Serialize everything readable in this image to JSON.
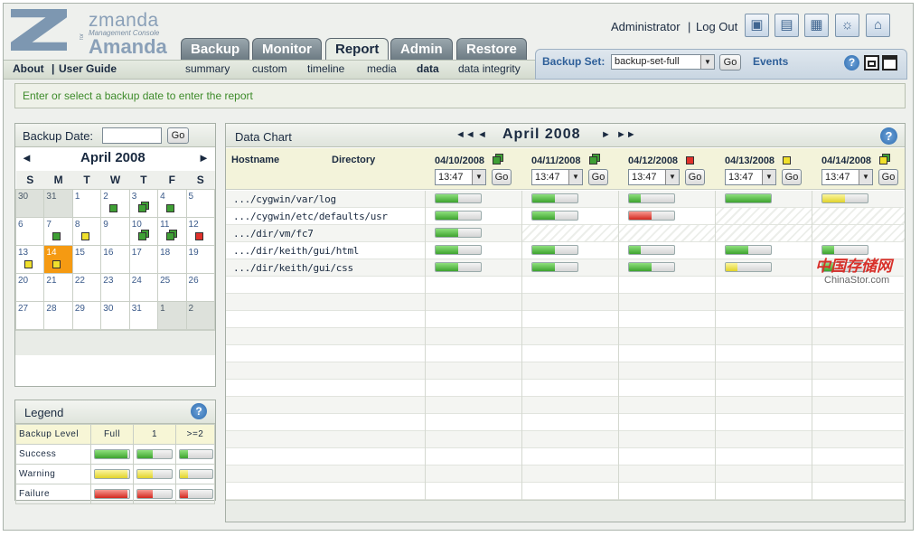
{
  "logo": {
    "brand": "zmanda",
    "tagline": "Management Console",
    "for": "for",
    "product": "Amanda"
  },
  "tabs": [
    {
      "label": "Backup"
    },
    {
      "label": "Monitor"
    },
    {
      "label": "Report",
      "active": true
    },
    {
      "label": "Admin"
    },
    {
      "label": "Restore"
    }
  ],
  "left_links": {
    "about": "About",
    "sep": "|",
    "guide": "User Guide"
  },
  "subtabs": [
    "summary",
    "custom",
    "timeline",
    "media",
    "data",
    "data integrity"
  ],
  "user": {
    "name": "Administrator",
    "sep": "|",
    "logout": "Log Out"
  },
  "top_icons": [
    "cart-icon",
    "book-icon",
    "map-icon",
    "lightbulb-icon",
    "home-icon"
  ],
  "backup_set": {
    "label": "Backup Set:",
    "value": "backup-set-full",
    "go": "Go",
    "events": "Events"
  },
  "message": "Enter or select a backup date to enter the report",
  "calendar": {
    "label": "Backup Date:",
    "go": "Go",
    "month": "April 2008",
    "prev": "◄",
    "next": "►",
    "days": [
      "S",
      "M",
      "T",
      "W",
      "T",
      "F",
      "S"
    ],
    "weeks": [
      [
        "30",
        "31",
        "1",
        "2",
        "3",
        "4",
        "5"
      ],
      [
        "6",
        "7",
        "8",
        "9",
        "10",
        "11",
        "12"
      ],
      [
        "13",
        "14",
        "15",
        "16",
        "17",
        "18",
        "19"
      ],
      [
        "20",
        "21",
        "22",
        "23",
        "24",
        "25",
        "26"
      ],
      [
        "27",
        "28",
        "29",
        "30",
        "31",
        "1",
        "2"
      ]
    ]
  },
  "legend": {
    "title": "Legend",
    "headers": [
      "Backup Level",
      "Full",
      "1",
      ">=2"
    ],
    "rows": [
      "Success",
      "Warning",
      "Failure"
    ]
  },
  "chart": {
    "title": "Data Chart",
    "month": "April 2008",
    "nav_first": "◄◄",
    "nav_prev": "◄",
    "nav_next": "►",
    "nav_last": "►►",
    "col_hostname": "Hostname",
    "col_directory": "Directory",
    "dates": [
      {
        "date": "04/10/2008",
        "time": "13:47",
        "go": "Go",
        "status": "green-stack"
      },
      {
        "date": "04/11/2008",
        "time": "13:47",
        "go": "Go",
        "status": "green-stack"
      },
      {
        "date": "04/12/2008",
        "time": "13:47",
        "go": "Go",
        "status": "red"
      },
      {
        "date": "04/13/2008",
        "time": "13:47",
        "go": "Go",
        "status": "yellow"
      },
      {
        "date": "04/14/2008",
        "time": "13:47",
        "go": "Go",
        "status": "yellow-stack"
      }
    ],
    "rows": [
      {
        "dir": ".../cygwin/var/log",
        "cells": [
          {
            "c": "g",
            "f": 0.5
          },
          {
            "c": "g",
            "f": 0.5
          },
          {
            "c": "g",
            "f": 0.25
          },
          {
            "c": "g",
            "f": 1.0
          },
          {
            "c": "y",
            "f": 0.5
          }
        ]
      },
      {
        "dir": ".../cygwin/etc/defaults/usr",
        "cells": [
          {
            "c": "g",
            "f": 0.5
          },
          {
            "c": "g",
            "f": 0.5
          },
          {
            "c": "r",
            "f": 0.5
          },
          null,
          null
        ]
      },
      {
        "dir": ".../dir/vm/fc7",
        "cells": [
          {
            "c": "g",
            "f": 0.5
          },
          null,
          null,
          null,
          null
        ]
      },
      {
        "dir": ".../dir/keith/gui/html",
        "cells": [
          {
            "c": "g",
            "f": 0.5
          },
          {
            "c": "g",
            "f": 0.5
          },
          {
            "c": "g",
            "f": 0.25
          },
          {
            "c": "g",
            "f": 0.5
          },
          {
            "c": "g",
            "f": 0.25
          }
        ]
      },
      {
        "dir": ".../dir/keith/gui/css",
        "cells": [
          {
            "c": "g",
            "f": 0.5
          },
          {
            "c": "g",
            "f": 0.5
          },
          {
            "c": "g",
            "f": 0.5
          },
          {
            "c": "y",
            "f": 0.25
          },
          {
            "c": "g",
            "f": 0.25
          }
        ]
      }
    ]
  },
  "watermark": {
    "cn": "中国存储网",
    "en": "ChinaStor.com"
  },
  "help": "?"
}
